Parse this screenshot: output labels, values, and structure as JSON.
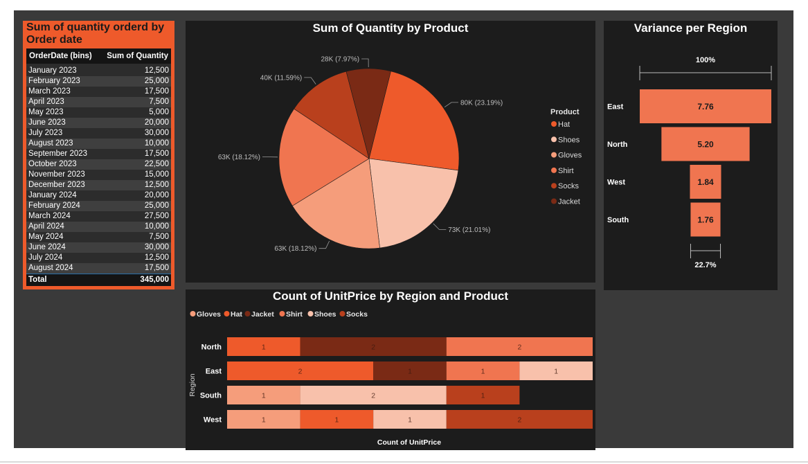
{
  "table": {
    "title": "Sum of quantity orderd by Order date",
    "col1": "OrderDate (bins)",
    "col2": "Sum of Quantity",
    "rows": [
      [
        "January 2023",
        "12,500"
      ],
      [
        "February 2023",
        "25,000"
      ],
      [
        "March 2023",
        "17,500"
      ],
      [
        "April 2023",
        "7,500"
      ],
      [
        "May 2023",
        "5,000"
      ],
      [
        "June 2023",
        "20,000"
      ],
      [
        "July 2023",
        "30,000"
      ],
      [
        "August 2023",
        "10,000"
      ],
      [
        "September 2023",
        "17,500"
      ],
      [
        "October 2023",
        "22,500"
      ],
      [
        "November 2023",
        "15,000"
      ],
      [
        "December 2023",
        "12,500"
      ],
      [
        "January 2024",
        "20,000"
      ],
      [
        "February 2024",
        "25,000"
      ],
      [
        "March 2024",
        "27,500"
      ],
      [
        "April 2024",
        "10,000"
      ],
      [
        "May 2024",
        "7,500"
      ],
      [
        "June 2024",
        "30,000"
      ],
      [
        "July 2024",
        "12,500"
      ],
      [
        "August 2024",
        "17,500"
      ]
    ],
    "total_label": "Total",
    "total_value": "345,000"
  },
  "chart_data": [
    {
      "type": "pie",
      "title": "Sum of Quantity by Product",
      "legend_title": "Product",
      "legend_position": "right",
      "slices": [
        {
          "name": "Hat",
          "value": 80000,
          "label": "80K (23.19%)",
          "color": "#ee5a2b"
        },
        {
          "name": "Shoes",
          "value": 72500,
          "label": "73K (21.01%)",
          "color": "#f8c1ab"
        },
        {
          "name": "Gloves",
          "value": 62500,
          "label": "63K (18.12%)",
          "color": "#f59d7b"
        },
        {
          "name": "Shirt",
          "value": 62500,
          "label": "63K (18.12%)",
          "color": "#f07550"
        },
        {
          "name": "Socks",
          "value": 40000,
          "label": "40K (11.59%)",
          "color": "#b9401d"
        },
        {
          "name": "Jacket",
          "value": 27500,
          "label": "28K (7.97%)",
          "color": "#7a2a15"
        }
      ]
    },
    {
      "type": "funnel",
      "title": "Variance per Region",
      "top_label": "100%",
      "bottom_label": "22.7%",
      "categories": [
        "East",
        "North",
        "West",
        "South"
      ],
      "values": [
        7.76,
        5.2,
        1.84,
        1.76
      ],
      "value_labels": [
        "7.76",
        "5.20",
        "1.84",
        "1.76"
      ],
      "color": "#f07550"
    },
    {
      "type": "bar",
      "orientation": "horizontal-stacked",
      "title": "Count of UnitPrice by Region and Product",
      "xlabel": "Count of UnitPrice",
      "ylabel": "Region",
      "legend_position": "top-left",
      "categories": [
        "North",
        "East",
        "South",
        "West"
      ],
      "series": [
        {
          "name": "Gloves",
          "color": "#f59d7b",
          "values": [
            0,
            0,
            1,
            1
          ]
        },
        {
          "name": "Hat",
          "color": "#ee5a2b",
          "values": [
            1,
            2,
            0,
            1
          ]
        },
        {
          "name": "Jacket",
          "color": "#7a2a15",
          "values": [
            2,
            1,
            0,
            0
          ]
        },
        {
          "name": "Shirt",
          "color": "#f07550",
          "values": [
            2,
            1,
            0,
            0
          ]
        },
        {
          "name": "Shoes",
          "color": "#f8c1ab",
          "values": [
            0,
            1,
            2,
            1
          ]
        },
        {
          "name": "Socks",
          "color": "#b9401d",
          "values": [
            0,
            0,
            1,
            2
          ]
        }
      ]
    }
  ]
}
